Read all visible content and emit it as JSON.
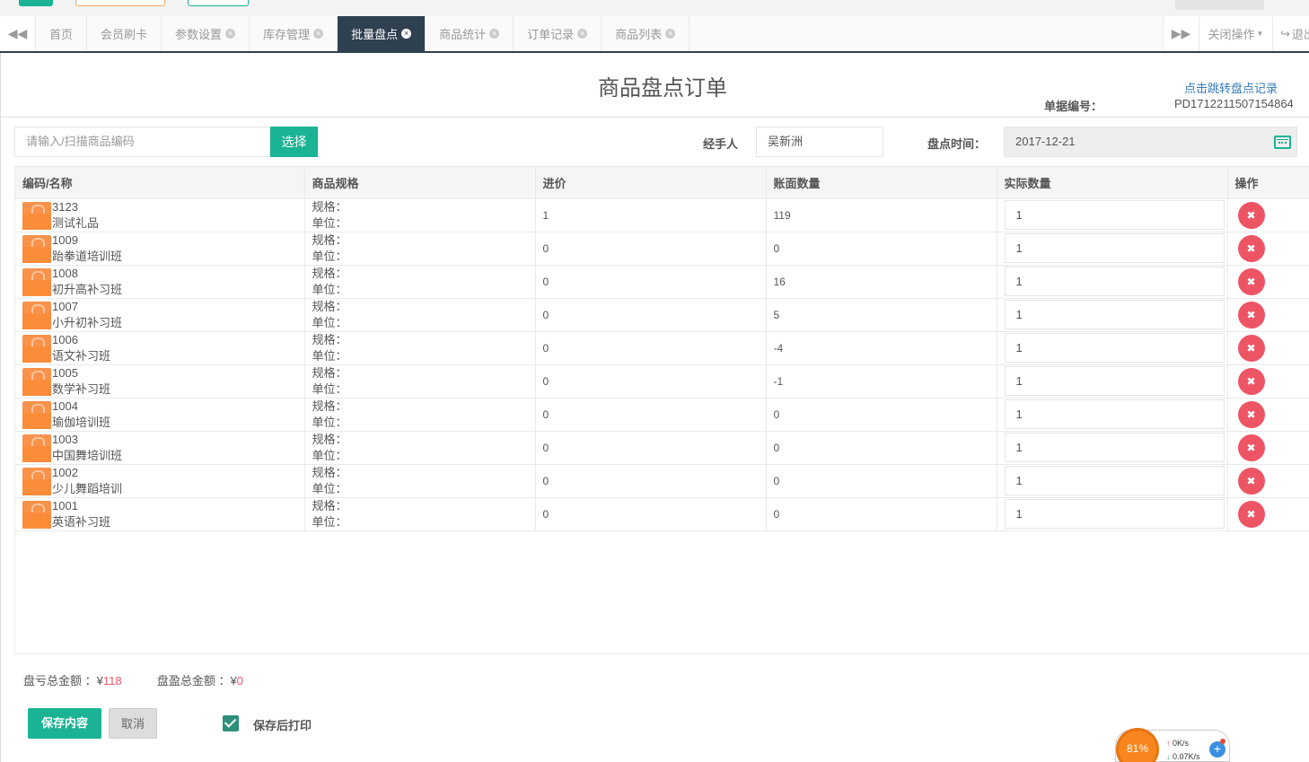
{
  "tabs": {
    "items": [
      {
        "label": "首页",
        "closable": false,
        "active": false
      },
      {
        "label": "会员刷卡",
        "closable": false,
        "active": false
      },
      {
        "label": "参数设置",
        "closable": true,
        "active": false
      },
      {
        "label": "库存管理",
        "closable": true,
        "active": false
      },
      {
        "label": "批量盘点",
        "closable": true,
        "active": true
      },
      {
        "label": "商品统计",
        "closable": true,
        "active": false
      },
      {
        "label": "订单记录",
        "closable": true,
        "active": false
      },
      {
        "label": "商品列表",
        "closable": true,
        "active": false
      }
    ],
    "close_ops": "关闭操作",
    "exit": "退出"
  },
  "page": {
    "title": "商品盘点订单",
    "jump_link": "点击跳转盘点记录",
    "bill_label": "单据编号：",
    "bill_no": "PD1712211507154864"
  },
  "form": {
    "search_placeholder": "请输入/扫描商品编码",
    "select_button": "选择",
    "handler_label": "经手人",
    "handler_value": "吴新洲",
    "date_label": "盘点时间：",
    "date_value": "2017-12-21"
  },
  "table": {
    "headers": [
      "编码/名称",
      "商品规格",
      "进价",
      "账面数量",
      "实际数量",
      "操作"
    ],
    "spec_label": "规格：",
    "unit_label": "单位：",
    "rows": [
      {
        "code": "3123",
        "name": "测试礼品",
        "price": "1",
        "book_qty": "119",
        "actual_qty": "1"
      },
      {
        "code": "1009",
        "name": "跆拳道培训班",
        "price": "0",
        "book_qty": "0",
        "actual_qty": "1"
      },
      {
        "code": "1008",
        "name": "初升高补习班",
        "price": "0",
        "book_qty": "16",
        "actual_qty": "1"
      },
      {
        "code": "1007",
        "name": "小升初补习班",
        "price": "0",
        "book_qty": "5",
        "actual_qty": "1"
      },
      {
        "code": "1006",
        "name": "语文补习班",
        "price": "0",
        "book_qty": "-4",
        "actual_qty": "1"
      },
      {
        "code": "1005",
        "name": "数学补习班",
        "price": "0",
        "book_qty": "-1",
        "actual_qty": "1"
      },
      {
        "code": "1004",
        "name": "瑜伽培训班",
        "price": "0",
        "book_qty": "0",
        "actual_qty": "1"
      },
      {
        "code": "1003",
        "name": "中国舞培训班",
        "price": "0",
        "book_qty": "0",
        "actual_qty": "1"
      },
      {
        "code": "1002",
        "name": "少儿舞蹈培训",
        "price": "0",
        "book_qty": "0",
        "actual_qty": "1"
      },
      {
        "code": "1001",
        "name": "英语补习班",
        "price": "0",
        "book_qty": "0",
        "actual_qty": "1"
      }
    ]
  },
  "footer": {
    "loss_label": "盘亏总金额 ：¥",
    "loss_value": "118",
    "gain_label": "盘盈总金额 ：¥",
    "gain_value": "0",
    "save_button": "保存内容",
    "cancel_button": "取消",
    "print_label": "保存后打印",
    "print_checked": true
  },
  "widget": {
    "percent": "81%",
    "up": "0K/s",
    "down": "0.07K/s"
  },
  "colors": {
    "primary": "#1ab394",
    "nav_dark": "#2f4050",
    "danger": "#ed5565",
    "link": "#337ab7"
  }
}
